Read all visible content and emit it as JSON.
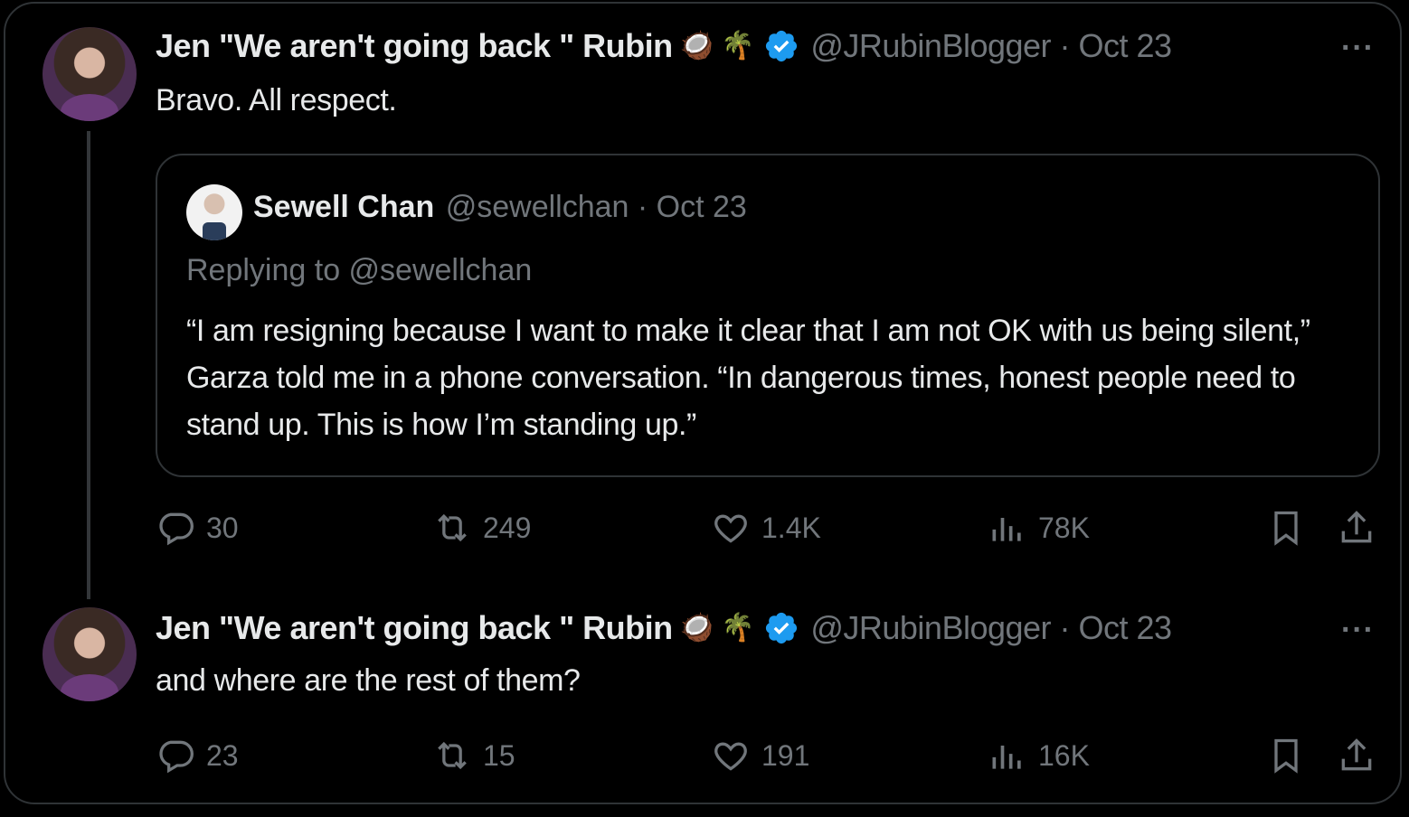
{
  "tweets": [
    {
      "author_name": "Jen \"We aren't going back \" Rubin",
      "emojis": [
        "🥥",
        "🌴"
      ],
      "handle_time": "@JRubinBlogger · Oct 23",
      "more": "···",
      "text": "Bravo. All respect.",
      "quote": {
        "author_name": "Sewell Chan",
        "handle_time": "@sewellchan · Oct 23",
        "replying_to": "Replying to @sewellchan",
        "body": "“I am resigning because I want to make it clear that I am not OK with us being silent,” Garza told me in a phone conversation. “In dangerous times, honest people need to stand up. This is how I’m standing up.”"
      },
      "stats": {
        "replies": "30",
        "reposts": "249",
        "likes": "1.4K",
        "views": "78K"
      }
    },
    {
      "author_name": "Jen \"We aren't going back \" Rubin",
      "emojis": [
        "🥥",
        "🌴"
      ],
      "handle_time": "@JRubinBlogger · Oct 23",
      "more": "···",
      "text": "and where are the rest of them?",
      "stats": {
        "replies": "23",
        "reposts": "15",
        "likes": "191",
        "views": "16K"
      }
    }
  ],
  "icons": {
    "reply": "reply-icon",
    "repost": "repost-icon",
    "like": "heart-icon",
    "views": "views-icon",
    "bookmark": "bookmark-icon",
    "share": "share-icon",
    "verified": "verified-badge-icon"
  },
  "colors": {
    "verified": "#1d9bf0",
    "muted": "#71767b",
    "text": "#e7e9ea",
    "border": "#2f3336"
  }
}
